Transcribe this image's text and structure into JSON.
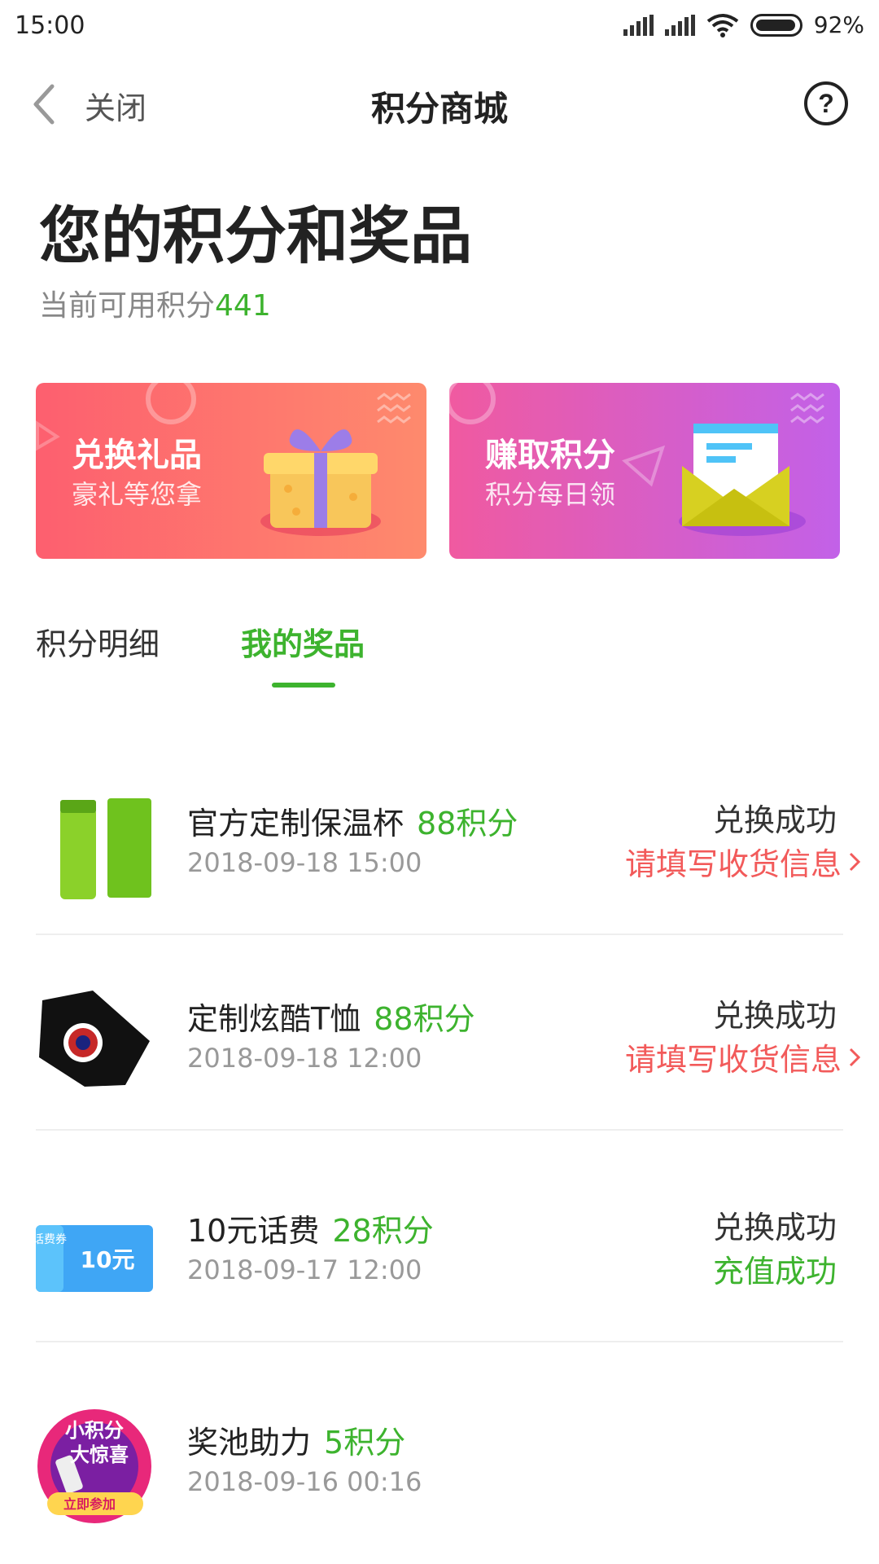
{
  "status_bar": {
    "time": "15:00",
    "battery": "92%"
  },
  "nav": {
    "close_label": "关闭",
    "title": "积分商城"
  },
  "header": {
    "title": "您的积分和奖品",
    "points_label": "当前可用积分",
    "points_value": "441"
  },
  "cards": [
    {
      "title": "兑换礼品",
      "subtitle": "豪礼等您拿"
    },
    {
      "title": "赚取积分",
      "subtitle": "积分每日领"
    }
  ],
  "tabs": [
    {
      "label": "积分明细",
      "active": false
    },
    {
      "label": "我的奖品",
      "active": true
    }
  ],
  "prizes": [
    {
      "name": "官方定制保温杯",
      "cost": "88积分",
      "date": "2018-09-18 15:00",
      "status": "兑换成功",
      "action": "请填写收货信息"
    },
    {
      "name": "定制炫酷T恤",
      "cost": "88积分",
      "date": "2018-09-18 12:00",
      "status": "兑换成功",
      "action": "请填写收货信息"
    },
    {
      "name": "10元话费",
      "cost": "28积分",
      "date": "2018-09-17 12:00",
      "status": "兑换成功",
      "action": "充值成功",
      "coupon_side": "话费券",
      "coupon_value": "10元"
    },
    {
      "name": "奖池助力",
      "cost": "5积分",
      "date": "2018-09-16 00:16",
      "promo_line1": "小积分",
      "promo_line2": "大惊喜",
      "promo_button": "立即参加"
    }
  ],
  "colors": {
    "accent_green": "#3db32e",
    "alert_red": "#f25a5a"
  }
}
